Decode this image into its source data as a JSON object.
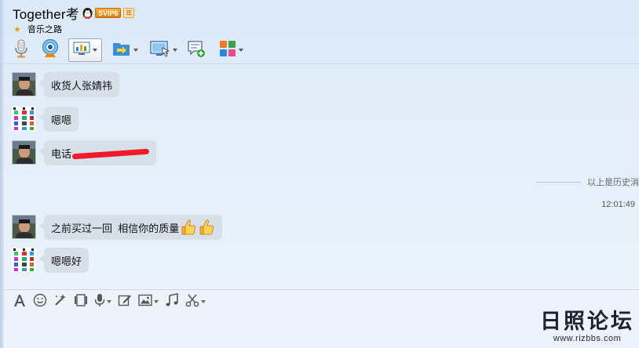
{
  "header": {
    "contact_name": "Together考",
    "vip_label": "SVIP6",
    "year_label": "年",
    "status_text": "音乐之路",
    "icons": [
      "microphone-icon",
      "camera-icon",
      "screen-share-icon",
      "file-transfer-icon",
      "remote-assist-icon",
      "new-discussion-icon",
      "apps-icon"
    ]
  },
  "messages": [
    {
      "sender": "contact",
      "text": "收货人张婧祎"
    },
    {
      "sender": "me",
      "text": "嗯嗯"
    },
    {
      "sender": "contact",
      "text": "电话",
      "redacted": true
    },
    {
      "sender": "contact",
      "text": "之前买过一回  相信你的质量",
      "emoji": [
        "thumbs-up",
        "thumbs-up"
      ]
    },
    {
      "sender": "me",
      "text": "嗯嗯好"
    }
  ],
  "history_divider": "以上是历史消",
  "timestamp": "12:01:49",
  "input_toolbar": {
    "icons": [
      "font-icon",
      "smiley-icon",
      "magic-wand-icon",
      "video-frame-icon",
      "voice-icon",
      "edit-icon",
      "image-icon",
      "music-icon",
      "scissors-icon"
    ]
  },
  "watermark": {
    "logo": "日照论坛",
    "url": "www.rizbbs.com"
  },
  "colors": {
    "bubble": "#d7dfe9",
    "vip_orange": "#e07b0b",
    "redaction": "#f01a2a",
    "background": "#e3edf8"
  }
}
